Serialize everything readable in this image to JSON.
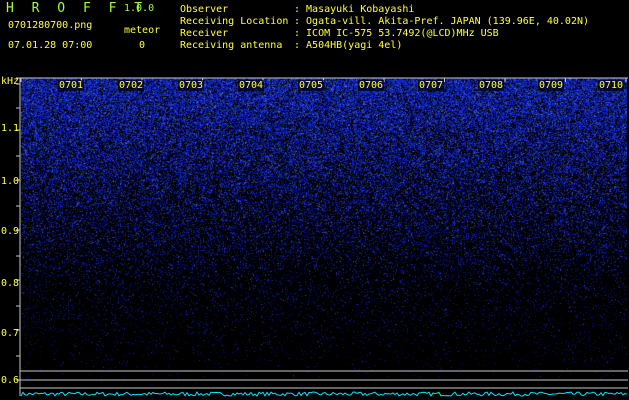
{
  "header": {
    "title": "H R O F F T",
    "version": "1.0.0",
    "filename": "0701280700.png",
    "meteor_label": "meteor",
    "datetime": "07.01.28 07:00",
    "meteor_count": "0"
  },
  "info": [
    {
      "key": "Observer",
      "value": ": Masayuki Kobayashi"
    },
    {
      "key": "Receiving Location",
      "value": ": Ogata-vill. Akita-Pref. JAPAN (139.96E, 40.02N)"
    },
    {
      "key": "Receiver",
      "value": ": ICOM IC-575 53.7492(@LCD)MHz USB"
    },
    {
      "key": "Receiving antenna",
      "value": ": A504HB(yagi 4el)"
    }
  ],
  "axis": {
    "unit": "kHz",
    "y_ticks": [
      "1.1",
      "1.0",
      "0.9",
      "0.8",
      "0.7",
      "0.6"
    ],
    "x_ticks": [
      "0701",
      "0702",
      "0703",
      "0704",
      "0705",
      "0706",
      "0707",
      "0708",
      "0709",
      "0710"
    ]
  },
  "colors": {
    "noise": "#3a4bff",
    "grid": "#c8c8c8",
    "baseline": "#00e5ff",
    "text": "#ffff40",
    "title": "#9eff3a"
  }
}
